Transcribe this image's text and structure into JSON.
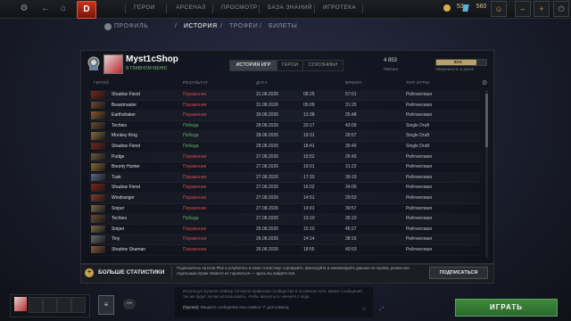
{
  "topbar": {
    "nav": [
      "ГЕРОИ",
      "АРСЕНАЛ",
      "ПРОСМОТР",
      "БАЗА ЗНАНИЙ",
      "ИГРОТЕКА"
    ],
    "gold": "53",
    "shards": "560"
  },
  "subnav": [
    "ПРОФИЛЬ",
    "ИСТОРИЯ",
    "ТРОФЕИ",
    "БИЛЕТЫ"
  ],
  "profile": {
    "name": "Myst1cShop",
    "status": "В ГЛАВНОМ МЕНЮ",
    "tabs": [
      "ИСТОРИЯ ИГР",
      "ГЕРОИ",
      "СОЮЗНИКИ"
    ],
    "mmr": "4 853",
    "mmr_label": "Рейтинг",
    "confidence": "81%",
    "confidence_value": 0.81,
    "confidence_label": "Уверенность в ранге"
  },
  "table": {
    "headers": [
      "ГЕРОЙ",
      "РЕЗУЛЬТАТ",
      "ДАТА",
      "ВРЕМЯ",
      "ТИП ИГРЫ"
    ],
    "rows": [
      {
        "hero": "Shadow Fiend",
        "result": "Поражение",
        "date": "31.08.2026",
        "time": "08:25",
        "duration": "57:01",
        "type": "Рейтинговая",
        "color": "#7a2418"
      },
      {
        "hero": "Beastmaster",
        "result": "Поражение",
        "date": "31.08.2026",
        "time": "05:09",
        "duration": "31:25",
        "type": "Рейтинговая",
        "color": "#6b4a2a"
      },
      {
        "hero": "Earthshaker",
        "result": "Поражение",
        "date": "30.08.2026",
        "time": "13:38",
        "duration": "25:48",
        "type": "Рейтинговая",
        "color": "#8a5a2a"
      },
      {
        "hero": "Techies",
        "result": "Победа",
        "date": "28.08.2026",
        "time": "20:17",
        "duration": "43:09",
        "type": "Single Draft",
        "color": "#6a4a30"
      },
      {
        "hero": "Monkey King",
        "result": "Победа",
        "date": "28.08.2026",
        "time": "19:31",
        "duration": "29:57",
        "type": "Single Draft",
        "color": "#8a6a3a"
      },
      {
        "hero": "Shadow Fiend",
        "result": "Победа",
        "date": "28.08.2026",
        "time": "18:41",
        "duration": "35:49",
        "type": "Single Draft",
        "color": "#7a2418"
      },
      {
        "hero": "Pudge",
        "result": "Поражение",
        "date": "27.08.2026",
        "time": "19:52",
        "duration": "26:43",
        "type": "Рейтинговая",
        "color": "#6a5a3a"
      },
      {
        "hero": "Bounty Hunter",
        "result": "Поражение",
        "date": "27.08.2026",
        "time": "19:01",
        "duration": "31:22",
        "type": "Рейтинговая",
        "color": "#8a6a2a"
      },
      {
        "hero": "Tusk",
        "result": "Поражение",
        "date": "27.08.2026",
        "time": "17:33",
        "duration": "39:19",
        "type": "Рейтинговая",
        "color": "#5a6a8a"
      },
      {
        "hero": "Shadow Fiend",
        "result": "Поражение",
        "date": "27.08.2026",
        "time": "16:52",
        "duration": "34:00",
        "type": "Рейтинговая",
        "color": "#7a2418"
      },
      {
        "hero": "Windranger",
        "result": "Поражение",
        "date": "27.08.2026",
        "time": "14:51",
        "duration": "29:53",
        "type": "Рейтинговая",
        "color": "#8a3a2a"
      },
      {
        "hero": "Sniper",
        "result": "Поражение",
        "date": "27.08.2026",
        "time": "14:01",
        "duration": "39:57",
        "type": "Рейтинговая",
        "color": "#7a6a4a"
      },
      {
        "hero": "Techies",
        "result": "Победа",
        "date": "27.08.2026",
        "time": "13:10",
        "duration": "35:10",
        "type": "Рейтинговая",
        "color": "#6a4a30"
      },
      {
        "hero": "Sniper",
        "result": "Поражение",
        "date": "26.08.2026",
        "time": "15:10",
        "duration": "45:27",
        "type": "Рейтинговая",
        "color": "#7a6a4a"
      },
      {
        "hero": "Tiny",
        "result": "Поражение",
        "date": "26.08.2026",
        "time": "14:14",
        "duration": "38:16",
        "type": "Рейтинговая",
        "color": "#6a6a6a"
      },
      {
        "hero": "Shadow Shaman",
        "result": "Поражение",
        "date": "26.08.2026",
        "time": "18:55",
        "duration": "40:53",
        "type": "Рейтинговая",
        "color": "#8a5a3a"
      }
    ]
  },
  "banner": {
    "title": "БОЛЬШЕ СТАТИСТИКИ",
    "text": "Подпишитесь на Dota Plus и углубитесь в свою статистику: сортируйте, фильтруйте и анализируйте данные по героям, ролям или отдельным играм. Можете не торопиться — здесь вы найдёте всё.",
    "button": "ПОДПИСАТЬСЯ"
  },
  "chat": {
    "text": "Используя Systems Кайзер согласно правилам сообщество в основном чате, ваших сообщений так же будет лучше использовать, чтобы вернуться, начните с кода.",
    "prompt_label": "(Группа):",
    "prompt": "Введите сообщение или символ \"/\" для команд"
  },
  "play_button": "ИГРАТЬ"
}
